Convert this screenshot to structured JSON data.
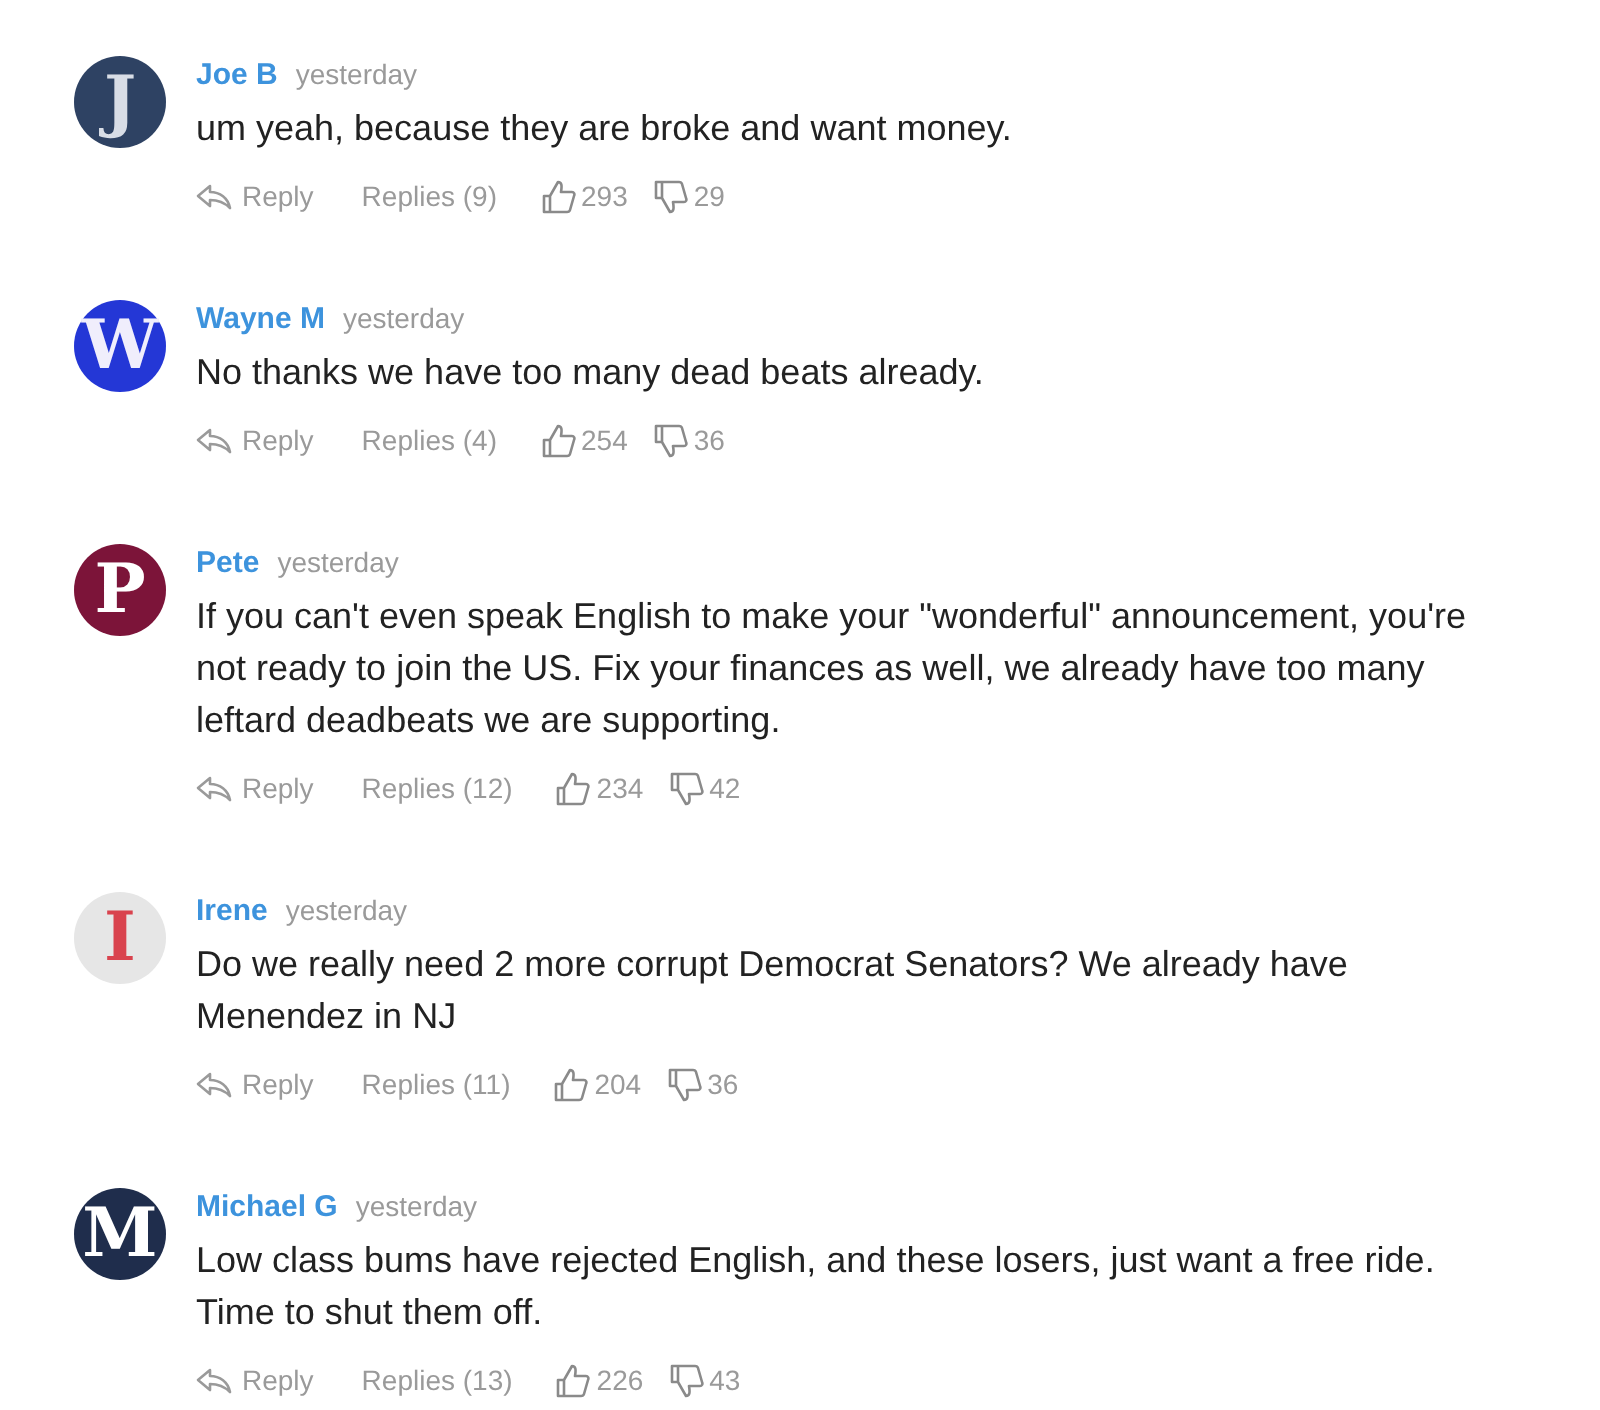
{
  "comments": [
    {
      "avatar": {
        "color": "#2e4263",
        "letter": {
          "text": "J",
          "color": "#d8dde6"
        }
      },
      "author": "Joe B",
      "time": "yesterday",
      "text": "um yeah, because they are broke and want money.",
      "reply": "Reply",
      "replies": "Replies (9)",
      "likes": "293",
      "dislikes": "29"
    },
    {
      "avatar": {
        "color": "#2437d6",
        "letter": {
          "text": "W",
          "color": "#f0eefc"
        }
      },
      "author": "Wayne M",
      "time": "yesterday",
      "text": "No thanks we have too many dead beats already.",
      "reply": "Reply",
      "replies": "Replies (4)",
      "likes": "254",
      "dislikes": "36"
    },
    {
      "avatar": {
        "color": "#7c1439",
        "letter": {
          "text": "P",
          "color": "#ffffff"
        }
      },
      "author": "Pete",
      "time": "yesterday",
      "text": "If you can't even speak English to make your \"wonderful\" announcement, you're not ready to join the US. Fix your finances as well, we already have too many leftard deadbeats we are supporting.",
      "reply": "Reply",
      "replies": "Replies (12)",
      "likes": "234",
      "dislikes": "42"
    },
    {
      "avatar": {
        "color": "#e6e6e6",
        "letter": {
          "text": "I",
          "color": "#d9434e"
        }
      },
      "author": "Irene",
      "time": "yesterday",
      "text": "Do we really need 2 more corrupt Democrat Senators? We already have Menendez in NJ",
      "reply": "Reply",
      "replies": "Replies (11)",
      "likes": "204",
      "dislikes": "36"
    },
    {
      "avatar": {
        "color": "#1f2d4c",
        "letter": {
          "text": "M",
          "color": "#ffffff"
        }
      },
      "author": "Michael G",
      "time": "yesterday",
      "text": "Low class bums have rejected English, and these losers, just want a free ride. Time to shut them off.",
      "reply": "Reply",
      "replies": "Replies (13)",
      "likes": "226",
      "dislikes": "43"
    }
  ]
}
